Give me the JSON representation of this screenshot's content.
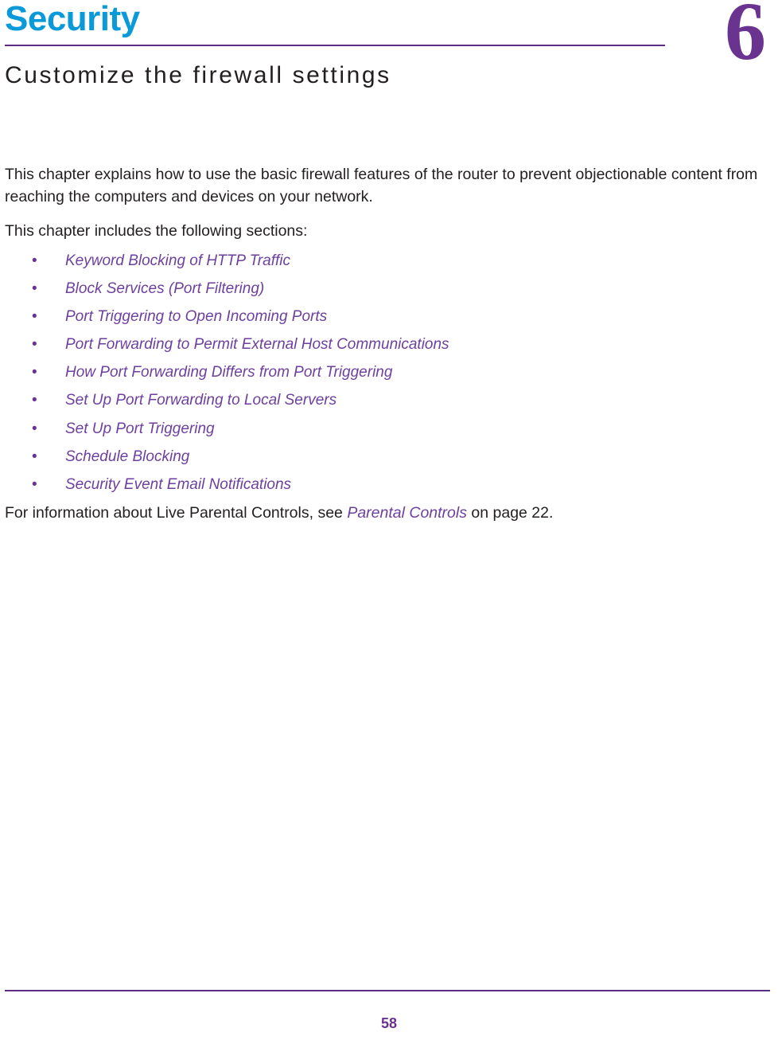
{
  "chapter": {
    "title": "Security",
    "subtitle": "Customize the firewall settings",
    "number": "6",
    "title_color": "#0a9ad9",
    "accent_color": "#5c2d82",
    "link_color": "#6d3f9e"
  },
  "intro": {
    "paragraph_1": "This chapter explains how to use the basic firewall features of the router to prevent objectionable content from reaching the computers and devices on your network.",
    "paragraph_2": "This chapter includes the following sections:"
  },
  "sections": [
    {
      "bullet": "•",
      "label": "Keyword Blocking of HTTP Traffic"
    },
    {
      "bullet": "•",
      "label": "Block Services (Port Filtering)"
    },
    {
      "bullet": "•",
      "label": "Port Triggering to Open Incoming Ports"
    },
    {
      "bullet": "•",
      "label": "Port Forwarding to Permit External Host Communications"
    },
    {
      "bullet": "•",
      "label": "How Port Forwarding Differs from Port Triggering"
    },
    {
      "bullet": "•",
      "label": "Set Up Port Forwarding to Local Servers"
    },
    {
      "bullet": "•",
      "label": "Set Up Port Triggering"
    },
    {
      "bullet": "•",
      "label": "Schedule Blocking"
    },
    {
      "bullet": "•",
      "label": "Security Event Email Notifications"
    }
  ],
  "closing": {
    "text_before": "For information about Live Parental Controls, see ",
    "link_label": "Parental Controls",
    "text_after": " on page 22."
  },
  "footer": {
    "page_number": "58"
  }
}
